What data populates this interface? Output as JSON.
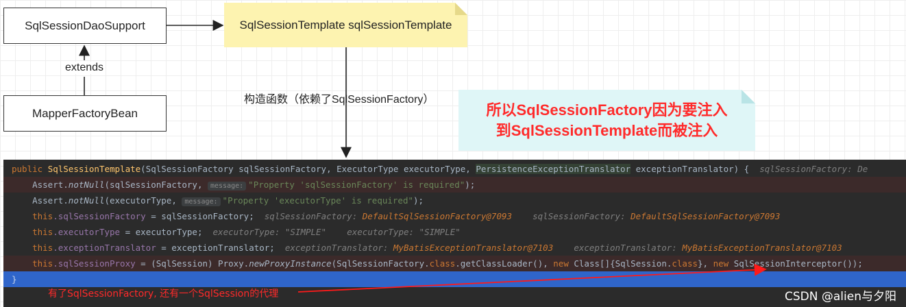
{
  "diagram": {
    "box_dao_support": "SqlSessionDaoSupport",
    "box_mapper_factory": "MapperFactoryBean",
    "note_template": "SqlSessionTemplate sqlSessionTemplate",
    "label_extends": "extends",
    "label_constructor": "构造函数（依赖了SqlSessionFactory）",
    "teal_note_line1": "所以SqlSessionFactory因为要注入",
    "teal_note_line2": "到SqlSessionTemplate而被注入"
  },
  "code": {
    "l1": {
      "public": "public ",
      "name": "SqlSessionTemplate",
      "a": "(SqlSessionFactory sqlSessionFactory, ExecutorType executorType, ",
      "hl": "PersistenceExceptionTranslator",
      "b": " exceptionTranslator) {",
      "hint": "  sqlSessionFactory: De"
    },
    "l2": {
      "a": "    Assert.",
      "m": "notNull",
      "b": "(sqlSessionFactory, ",
      "pill": "message:",
      "s": "\"Property 'sqlSessionFactory' is required\"",
      "c": ");"
    },
    "l3": {
      "a": "    Assert.",
      "m": "notNull",
      "b": "(executorType, ",
      "pill": "message:",
      "s": "\"Property 'executorType' is required\"",
      "c": ");"
    },
    "l4": {
      "this": "    this",
      "f": ".sqlSessionFactory",
      "b": " = sqlSessionFactory;",
      "h1": "  sqlSessionFactory: ",
      "v1": "DefaultSqlSessionFactory@7093",
      "h2": "    sqlSessionFactory: ",
      "v2": "DefaultSqlSessionFactory@7093"
    },
    "l5": {
      "this": "    this",
      "f": ".executorType",
      "b": " = executorType;",
      "h1": "  executorType: \"SIMPLE\"",
      "h2": "    executorType: \"SIMPLE\""
    },
    "l6": {
      "this": "    this",
      "f": ".exceptionTranslator",
      "b": " = exceptionTranslator;",
      "h1": "  exceptionTranslator: ",
      "v1": "MyBatisExceptionTranslator@7103",
      "h2": "    exceptionTranslator: ",
      "v2": "MyBatisExceptionTranslator@7103"
    },
    "l7": {
      "this": "    this",
      "f": ".sqlSessionProxy",
      "b": " = (SqlSession) Proxy.",
      "m": "newProxyInstance",
      "c": "(SqlSessionFactory.",
      "cls": "class",
      "d": ".getClassLoader(), ",
      "new1": "new",
      "e": " Class[]{SqlSession.",
      "cls2": "class",
      "f2": "}, ",
      "new2": "new",
      "g": " SqlSessionInterceptor());"
    },
    "l8": "}"
  },
  "annotation": "有了SqlSessionFactory, 还有一个SqlSession的代理",
  "watermark": "CSDN @alien与夕阳"
}
